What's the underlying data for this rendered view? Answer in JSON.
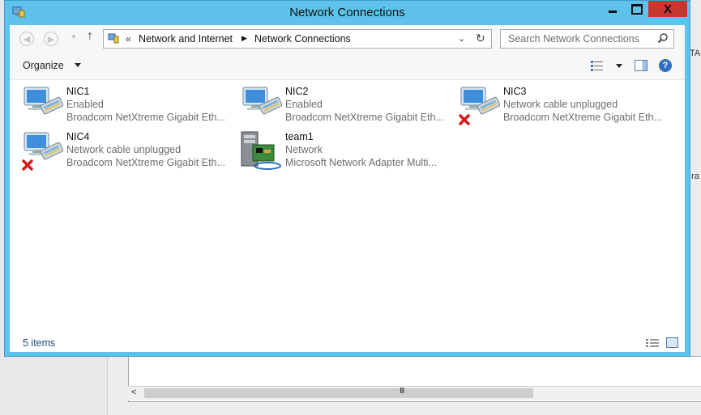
{
  "window": {
    "title": "Network Connections",
    "accent_color": "#5ec2ea",
    "close_color": "#c7372f"
  },
  "controls": {
    "minimize_icon": "minimize-icon",
    "maximize_icon": "maximize-icon",
    "close_icon": "close-icon",
    "close_glyph": "X"
  },
  "address": {
    "prefix": "«",
    "crumbs": [
      "Network and Internet",
      "Network Connections"
    ],
    "separator": "▶"
  },
  "search": {
    "placeholder": "Search Network Connections"
  },
  "toolbar": {
    "organize_label": "Organize"
  },
  "items": [
    {
      "name": "NIC1",
      "status": "Enabled",
      "device": "Broadcom NetXtreme Gigabit Eth...",
      "icon": "network-adapter-icon",
      "disconnected": false
    },
    {
      "name": "NIC2",
      "status": "Enabled",
      "device": "Broadcom NetXtreme Gigabit Eth...",
      "icon": "network-adapter-icon",
      "disconnected": false
    },
    {
      "name": "NIC3",
      "status": "Network cable unplugged",
      "device": "Broadcom NetXtreme Gigabit Eth...",
      "icon": "network-adapter-disconnected-icon",
      "disconnected": true
    },
    {
      "name": "NIC4",
      "status": "Network cable unplugged",
      "device": "Broadcom NetXtreme Gigabit Eth...",
      "icon": "network-adapter-disconnected-icon",
      "disconnected": true
    },
    {
      "name": "team1",
      "status": "Network",
      "device": "Microsoft Network Adapter Multi...",
      "icon": "team-adapter-icon",
      "disconnected": false
    }
  ],
  "status_bar": {
    "count_text": "5 items"
  },
  "background": {
    "scroll_left_arrow": "<",
    "scroll_grip": "III",
    "edge_text_1": "TA",
    "edge_text_2": "ra"
  }
}
